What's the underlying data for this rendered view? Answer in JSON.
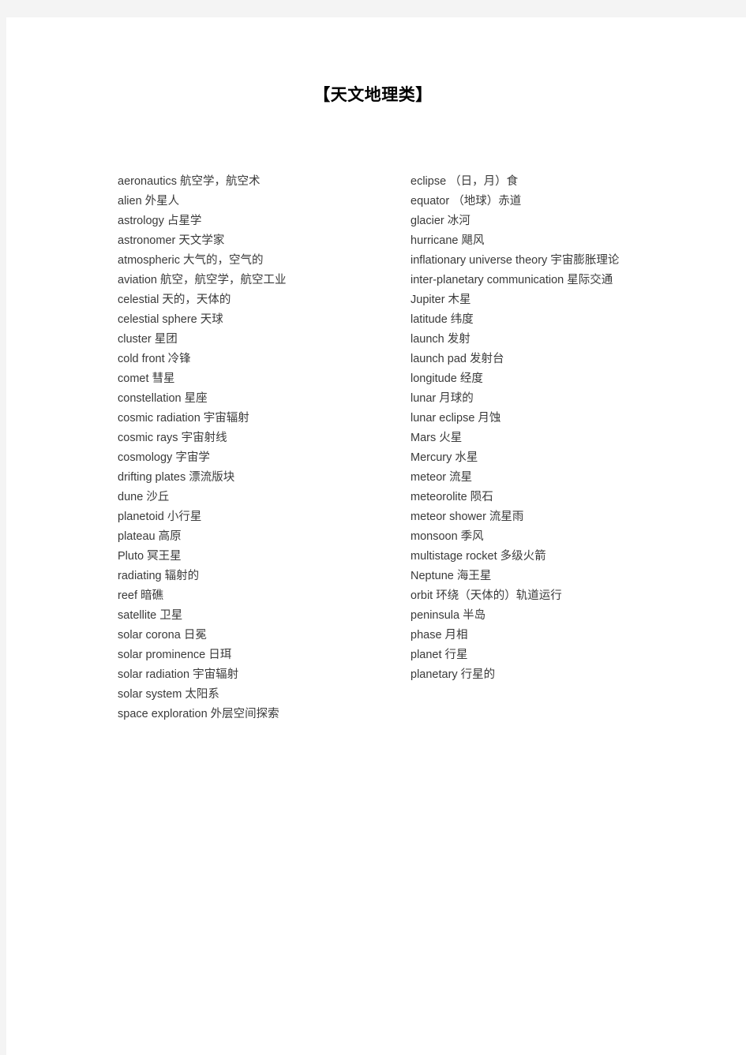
{
  "document": {
    "title": "【天文地理类】",
    "background_color": "#f4f4f4",
    "page_color": "#ffffff",
    "text_color": "#3a3a3a"
  },
  "columns": {
    "left": [
      "aeronautics 航空学，航空术",
      "alien 外星人",
      "astrology 占星学",
      "astronomer 天文学家",
      "atmospheric 大气的，空气的",
      "aviation 航空，航空学，航空工业",
      "celestial 天的，天体的",
      "celestial  sphere 天球",
      "cluster 星团",
      "cold  front 冷锋",
      "comet 彗星",
      "constellation 星座",
      "cosmic  radiation 宇宙辐射",
      "cosmic  rays 宇宙射线",
      "cosmology 字宙学",
      "drifting  plates 漂流版块",
      "dune 沙丘",
      "planetoid 小行星",
      "plateau 高原",
      "Pluto 冥王星",
      "radiating 辐射的",
      "reef 暗礁",
      "satellite 卫星",
      "solar  corona 日冕",
      "solar  prominence 日珥",
      "solar  radiation 宇宙辐射",
      "solar  system 太阳系",
      "space  exploration 外层空间探索"
    ],
    "right": [
      "eclipse  （日，月）食",
      "equator  （地球）赤道",
      "glacier 冰河",
      "hurricane 飓风",
      "inflationary  universe  theory 宇宙膨胀理论",
      "inter-planetary  communication 星际交通",
      "Jupiter 木星",
      "latitude 纬度",
      "launch 发射",
      "launch  pad 发射台",
      "longitude 经度",
      "lunar 月球的",
      "lunar  eclipse 月蚀",
      "Mars 火星",
      "Mercury 水星",
      "meteor 流星",
      "meteorolite 陨石",
      "meteor  shower 流星雨",
      "monsoon 季风",
      "multistage  rocket 多级火箭",
      "Neptune 海王星",
      "orbit 环绕（天体的）轨道运行",
      "peninsula 半岛",
      "phase 月相",
      "planet 行星",
      "planetary 行星的"
    ]
  }
}
